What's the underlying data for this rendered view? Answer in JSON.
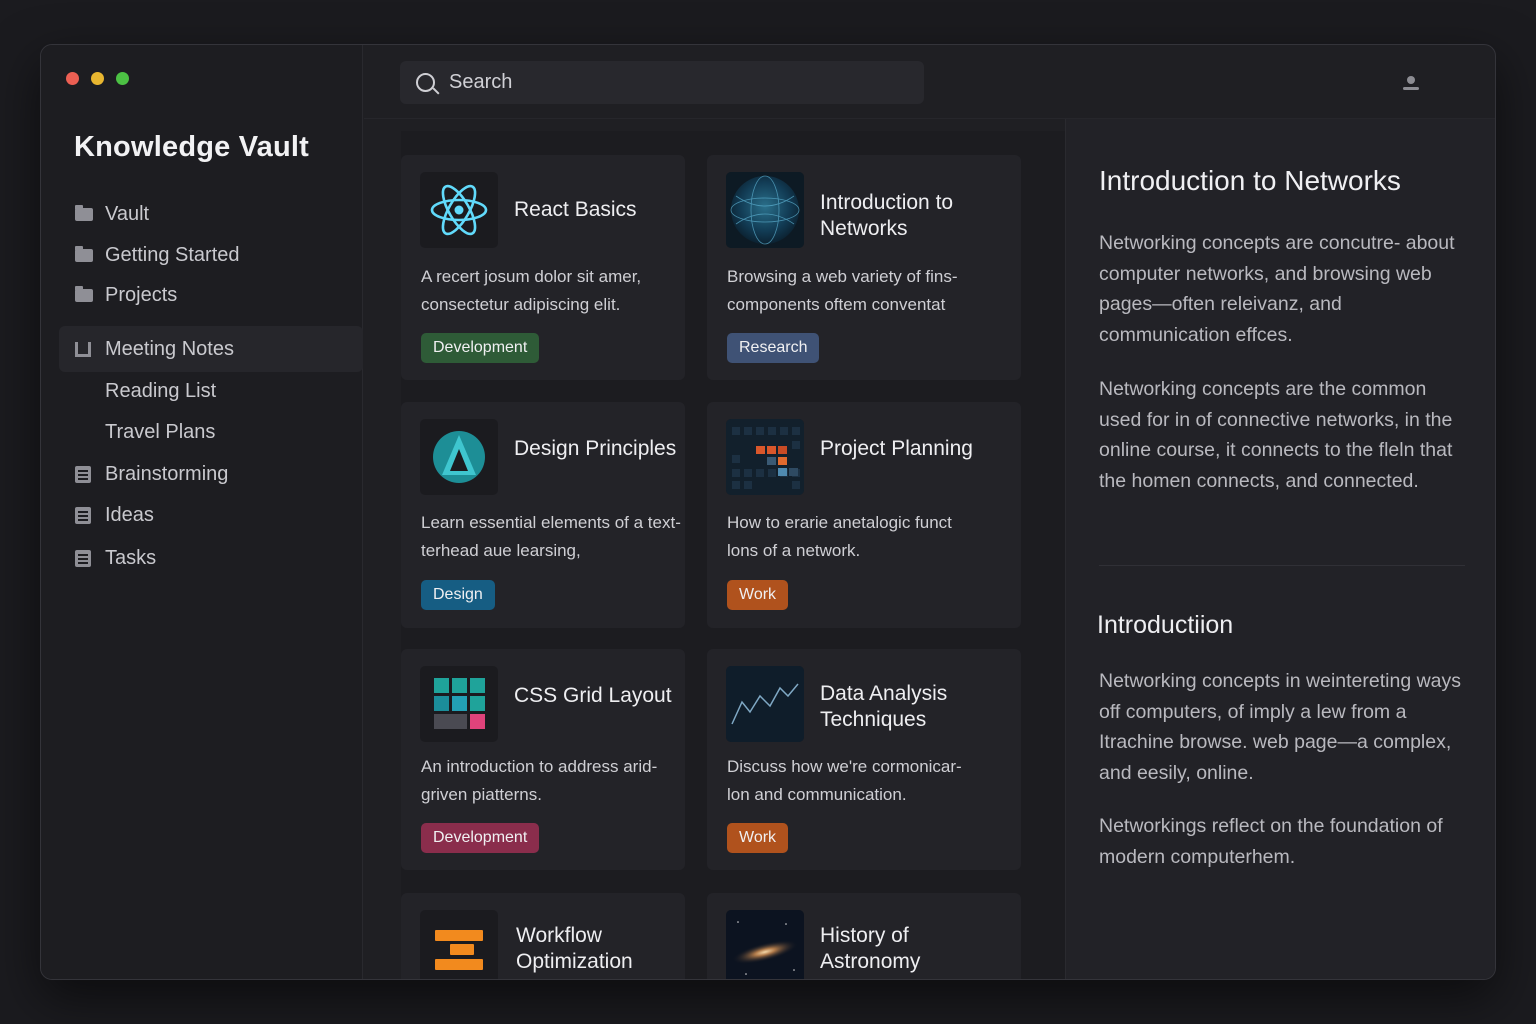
{
  "app": {
    "title": "Knowledge Vault"
  },
  "sidebar": {
    "items": [
      {
        "label": "Vault",
        "icon": "folder-icon"
      },
      {
        "label": "Getting Started",
        "icon": "folder-icon"
      },
      {
        "label": "Projects",
        "icon": "folder-icon"
      },
      {
        "label": "Meeting Notes",
        "icon": "notebook-icon",
        "active": true
      },
      {
        "label": "Reading List",
        "icon": ""
      },
      {
        "label": "Travel Plans",
        "icon": ""
      },
      {
        "label": "Brainstorming",
        "icon": "document-icon"
      },
      {
        "label": "Ideas",
        "icon": "document-icon"
      },
      {
        "label": "Tasks",
        "icon": "document-icon"
      }
    ]
  },
  "search": {
    "placeholder": "Search"
  },
  "cards": [
    {
      "title": "React Basics",
      "desc": "A recert josum dolor sit amer, consectetur adipiscing elit.",
      "tag": "Development",
      "icon": "react-atom-icon",
      "tag_color": "#2e5b37"
    },
    {
      "title": "Introduction to Networks",
      "desc": "Browsing a web variety of fins- components oftem conventat",
      "tag": "Research",
      "icon": "globe-network-icon",
      "tag_color": "#3f5275"
    },
    {
      "title": "Design Principles",
      "desc": "Learn essential elements of a text-terhead aue learsing,",
      "tag": "Design",
      "icon": "triangle-logo-icon",
      "tag_color": "#165d83"
    },
    {
      "title": "Project Planning",
      "desc": "How to erarie anetalogic funct lons of a network.",
      "tag": "Work",
      "icon": "pixel-grid-icon",
      "tag_color": "#b0521d"
    },
    {
      "title": "CSS Grid Layout",
      "desc": "An introduction to address arid-griven piatterns.",
      "tag": "Development",
      "icon": "grid-layout-icon",
      "tag_color": "#8a2d4c"
    },
    {
      "title": "Data Analysis Techniques",
      "desc": "Discuss how we're cormonicar- lon and communication.",
      "tag": "Work",
      "icon": "line-chart-icon",
      "tag_color": "#b0521d"
    },
    {
      "title": "Workflow Optimization",
      "desc": "",
      "tag": "",
      "icon": "stacked-bars-icon"
    },
    {
      "title": "History of Astronomy",
      "desc": "",
      "tag": "",
      "icon": "galaxy-icon"
    }
  ],
  "detail": {
    "title": "Introduction to Networks",
    "paragraphs": [
      "Networking concepts are concutre- about computer networks, and browsing web pages—often releivanz, and communication effces.",
      "Networking concepts are the common used for in of connective networks, in the online course, it connects to the fleln that the homen connects, and connected."
    ],
    "section_heading": "Introductiion",
    "section_paragraphs": [
      "Networking concepts in weintereting ways off computers, of imply a lew from a Itrachine browse.  web page—a complex, and eesily, online.",
      "Networkings reflect on the foundation of modern computerhem."
    ]
  },
  "colors": {
    "window_bg": "#1f1f23",
    "accent_react": "#61dafb",
    "tag_development": "#2e5b37",
    "tag_research": "#3f5275",
    "tag_design": "#165d83",
    "tag_work": "#b0521d",
    "tag_development_alt": "#8a2d4c"
  }
}
